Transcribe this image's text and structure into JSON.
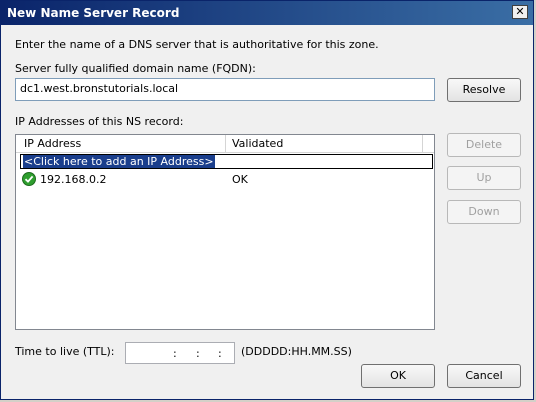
{
  "window": {
    "title": "New Name Server Record",
    "close_glyph": "✕"
  },
  "intro_text": "Enter the name of a DNS server that is authoritative for this zone.",
  "fqdn": {
    "label": "Server fully qualified domain name (FQDN):",
    "value": "dc1.west.bronstutorials.local"
  },
  "buttons": {
    "resolve": "Resolve",
    "delete": "Delete",
    "up": "Up",
    "down": "Down",
    "ok": "OK",
    "cancel": "Cancel"
  },
  "ip_list": {
    "label": "IP Addresses of this NS record:",
    "columns": [
      "IP Address",
      "Validated"
    ],
    "add_placeholder": "<Click here to add an IP Address>",
    "rows": [
      {
        "ip": "192.168.0.2",
        "validated": "OK",
        "icon": "green-check-icon"
      }
    ]
  },
  "ttl": {
    "label": "Time to live (TTL):",
    "separators": [
      ":",
      ":",
      ":"
    ],
    "format_hint": "(DDDDD:HH.MM.SS)"
  },
  "colors": {
    "title_gradient_start": "#0a246a",
    "selection": "#1a3e8c",
    "check_green": "#2e9e2e"
  }
}
